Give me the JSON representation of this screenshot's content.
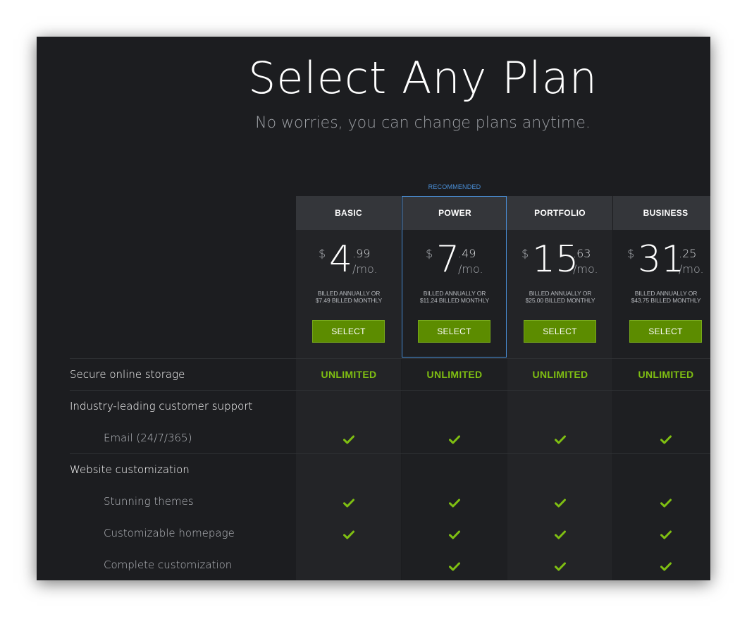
{
  "header": {
    "title": "Select Any Plan",
    "subtitle": "No worries, you can change plans anytime."
  },
  "recommended_label": "RECOMMENDED",
  "plans": [
    {
      "name": "BASIC",
      "currency": "$",
      "whole": "4",
      "cents": ".99",
      "per": "/mo.",
      "billing_line1": "BILLED ANNUALLY OR",
      "billing_line2": "$7.49 BILLED MONTHLY",
      "select_label": "SELECT"
    },
    {
      "name": "POWER",
      "currency": "$",
      "whole": "7",
      "cents": ".49",
      "per": "/mo.",
      "billing_line1": "BILLED ANNUALLY OR",
      "billing_line2": "$11.24 BILLED MONTHLY",
      "select_label": "SELECT"
    },
    {
      "name": "PORTFOLIO",
      "currency": "$",
      "whole": "15",
      "cents": ".63",
      "per": "/mo.",
      "billing_line1": "BILLED ANNUALLY OR",
      "billing_line2": "$25.00 BILLED MONTHLY",
      "select_label": "SELECT"
    },
    {
      "name": "BUSINESS",
      "currency": "$",
      "whole": "31",
      "cents": ".25",
      "per": "/mo.",
      "billing_line1": "BILLED ANNUALLY OR",
      "billing_line2": "$43.75 BILLED MONTHLY",
      "select_label": "SELECT"
    }
  ],
  "features": {
    "storage": {
      "label": "Secure online storage",
      "values": [
        "UNLIMITED",
        "UNLIMITED",
        "UNLIMITED",
        "UNLIMITED"
      ]
    },
    "support": {
      "label": "Industry-leading customer support"
    },
    "email": {
      "label": "Email (24/7/365)",
      "included": [
        true,
        true,
        true,
        true
      ]
    },
    "customization": {
      "label": "Website customization"
    },
    "themes": {
      "label": "Stunning themes",
      "included": [
        true,
        true,
        true,
        true
      ]
    },
    "homepage": {
      "label": "Customizable homepage",
      "included": [
        true,
        true,
        true,
        true
      ]
    },
    "complete": {
      "label": "Complete customization",
      "included": [
        false,
        true,
        true,
        true
      ]
    }
  },
  "colors": {
    "accent_green": "#5c8c00",
    "check_green": "#7fbf12",
    "recommended_blue": "#4a90d9"
  },
  "icons": {
    "included": "checkmark-icon"
  }
}
